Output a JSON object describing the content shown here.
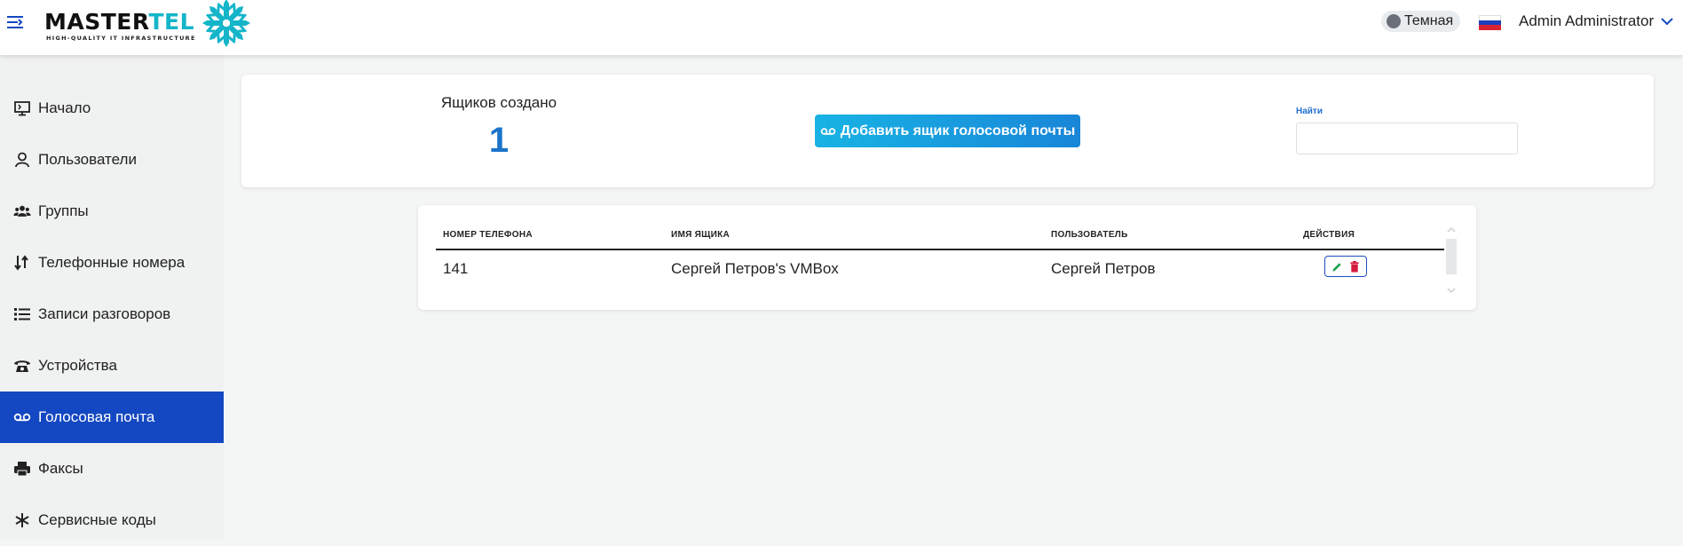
{
  "brand": {
    "name_part1": "MASTER",
    "name_part2": "TEL",
    "tagline": "HIGH-QUALITY IT INFRASTRUCTURE",
    "accent_color": "#14b5c9"
  },
  "header": {
    "theme_label": "Темная",
    "user_name": "Admin Administrator",
    "language_flag": "ru-flag-icon"
  },
  "sidebar": {
    "active_color": "#1448c2",
    "items": [
      {
        "label": "Начало",
        "icon": "monitor-icon",
        "active": false
      },
      {
        "label": "Пользователи",
        "icon": "user-icon",
        "active": false
      },
      {
        "label": "Группы",
        "icon": "users-group-icon",
        "active": false
      },
      {
        "label": "Телефонные номера",
        "icon": "sort-arrows-icon",
        "active": false
      },
      {
        "label": "Записи разговоров",
        "icon": "list-icon",
        "active": false
      },
      {
        "label": "Устройства",
        "icon": "phone-icon",
        "active": false
      },
      {
        "label": "Голосовая почта",
        "icon": "voicemail-icon",
        "active": true
      },
      {
        "label": "Факсы",
        "icon": "printer-icon",
        "active": false
      },
      {
        "label": "Сервисные коды",
        "icon": "asterisk-icon",
        "active": false
      }
    ]
  },
  "stats": {
    "title": "Ящиков создано",
    "value": "1",
    "value_color": "#1b74c8"
  },
  "actions": {
    "add_button_label": "Добавить ящик голосовой почты"
  },
  "search": {
    "label": "Найти",
    "value": "",
    "placeholder": ""
  },
  "table": {
    "columns": [
      "НОМЕР ТЕЛЕФОНА",
      "ИМЯ ЯЩИКА",
      "ПОЛЬЗОВАТЕЛЬ",
      "ДЕЙСТВИЯ"
    ],
    "rows": [
      {
        "phone": "141",
        "box_name": "Сергей Петров's VMBox",
        "user": "Сергей Петров"
      }
    ]
  }
}
